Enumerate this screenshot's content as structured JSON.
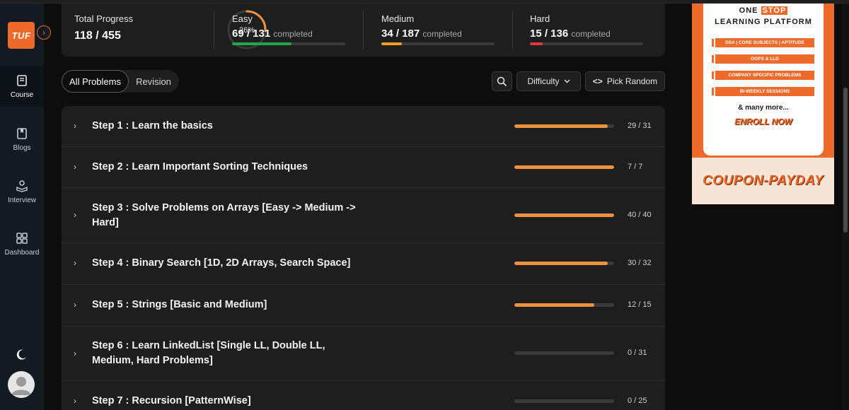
{
  "sidebar": {
    "logo": "TUF",
    "items": [
      {
        "label": "Course",
        "icon": "book-icon"
      },
      {
        "label": "Blogs",
        "icon": "bookmark-icon"
      },
      {
        "label": "Interview",
        "icon": "interview-icon"
      },
      {
        "label": "Dashboard",
        "icon": "dashboard-icon"
      }
    ]
  },
  "stats": {
    "total": {
      "title": "Total Progress",
      "value": "118 / 455",
      "percent_label": "26%",
      "fraction": 0.26
    },
    "easy": {
      "title": "Easy",
      "value": "69 / 131",
      "suffix": "completed",
      "fraction": 0.527,
      "color": "#22a548"
    },
    "medium": {
      "title": "Medium",
      "value": "34 / 187",
      "suffix": "completed",
      "fraction": 0.182,
      "color": "#f0a01f"
    },
    "hard": {
      "title": "Hard",
      "value": "15 / 136",
      "suffix": "completed",
      "fraction": 0.11,
      "color": "#e0383e"
    }
  },
  "tabs": {
    "all": "All Problems",
    "revision": "Revision"
  },
  "toolbar": {
    "difficulty": "Difficulty",
    "random": "Pick Random"
  },
  "steps": [
    {
      "title": "Step 1 : Learn the basics",
      "count": "29 / 31",
      "fraction": 0.935
    },
    {
      "title": "Step 2 : Learn Important Sorting Techniques",
      "count": "7 / 7",
      "fraction": 1.0
    },
    {
      "title": "Step 3 : Solve Problems on Arrays [Easy -> Medium -> Hard]",
      "count": "40 / 40",
      "fraction": 1.0
    },
    {
      "title": "Step 4 : Binary Search [1D, 2D Arrays, Search Space]",
      "count": "30 / 32",
      "fraction": 0.9375
    },
    {
      "title": "Step 5 : Strings [Basic and Medium]",
      "count": "12 / 15",
      "fraction": 0.8
    },
    {
      "title": "Step 6 : Learn LinkedList [Single LL, Double LL, Medium, Hard Problems]",
      "count": "0 / 31",
      "fraction": 0
    },
    {
      "title": "Step 7 : Recursion [PatternWise]",
      "count": "0 / 25",
      "fraction": 0
    }
  ],
  "ad": {
    "line1_a": "ONE ",
    "line1_b": "STOP",
    "line2": "LEARNING PLATFORM",
    "pills": [
      "DSA | CORE SUBJECTS | APTITUDE",
      "OOPS & LLD",
      "COMPANY SPECIFIC PROBLEMS",
      "BI-WEEKLY SESSIONS"
    ],
    "more": "& many more...",
    "enroll": "ENROLL NOW",
    "coupon": "COUPON-PAYDAY"
  },
  "colors": {
    "accent": "#ee6a2b",
    "progress": "#f0913e"
  }
}
